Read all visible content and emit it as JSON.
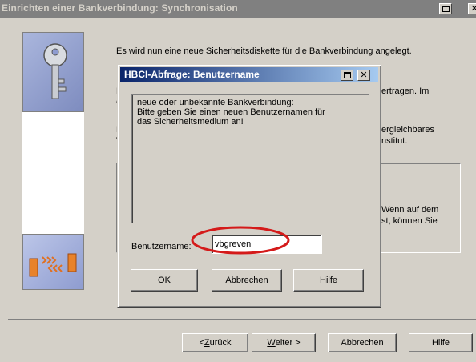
{
  "window": {
    "title": "Einrichten einer Bankverbindung: Synchronisation"
  },
  "intro_text": "Es wird nun eine neue Sicherheitsdiskette für die Bankverbindung angelegt.",
  "background_fragments": {
    "frag1": "D",
    "frag2": "ertragen. Im",
    "frag3": "G",
    "frag4": "H",
    "frag5": "ergleichbares",
    "frag6": "V",
    "frag7": "nstitut.",
    "frag8": "Wenn auf dem",
    "frag9": "st, können Sie"
  },
  "wizard_buttons": {
    "back": {
      "pre": "< ",
      "underline": "Z",
      "post": "urück"
    },
    "next": {
      "underline": "W",
      "post": "eiter >"
    },
    "cancel": "Abbrechen",
    "help": "Hilfe"
  },
  "dialog": {
    "title": "HBCI-Abfrage: Benutzername",
    "message": "neue oder unbekannte Bankverbindung:\n Bitte geben Sie einen neuen Benutzernamen für\ndas Sicherheitsmedium an!",
    "username_label": "Benutzername:",
    "username_value": "vbgreven",
    "ok": "OK",
    "cancel": "Abbrechen",
    "help": {
      "underline": "H",
      "post": "ilfe"
    }
  },
  "colors": {
    "dialog_titlebar": "#0a246a",
    "inactive_titlebar": "#808080",
    "highlight_ellipse": "#d41a1a"
  },
  "icons": {
    "top_panel": "key-icon",
    "bottom_panel": "sync-arrows-icon"
  }
}
